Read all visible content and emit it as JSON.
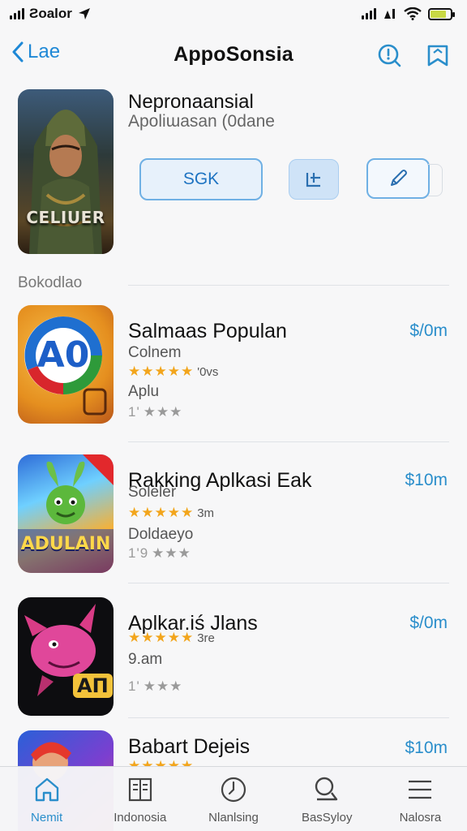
{
  "status_bar": {
    "carrier": "Ƨoalor",
    "battery_level": 0.8
  },
  "nav": {
    "back_label": "Lae",
    "title": "AppoSonsia"
  },
  "hero": {
    "title": "Nepronaansial",
    "subtitle": "Apoliɯasan (0dane",
    "cover_text": "CELIUER",
    "primary_button": "SGK"
  },
  "section": {
    "label": "Bokodlao"
  },
  "apps": [
    {
      "name": "Salmaas Populan",
      "price": "$/0m",
      "subtitle": "Colnem",
      "rating_note": "'0vs",
      "detail": "Aplu",
      "rating_gold": "★★★★★",
      "rating_grey_prefix": "1'",
      "rating_grey": "★★★",
      "icon_text": "A0"
    },
    {
      "name": "Rakking Aplkasi Eak",
      "price": "$10m",
      "subtitle": "Soleler",
      "rating_note": "3m",
      "detail": "Doldaeyo",
      "rating_gold": "★★★★★",
      "rating_grey_prefix": "1'9",
      "rating_grey": "★★★",
      "icon_text": "ADULAIN"
    },
    {
      "name": "Aplkar.iś Jlans",
      "price": "$/0m",
      "subtitle": "",
      "rating_note": "3re",
      "detail": "9.am",
      "rating_gold": "★★★★★",
      "rating_grey_prefix": "1'",
      "rating_grey": "★★★",
      "icon_text": "AΠ"
    },
    {
      "name": "Babart Dejeis",
      "price": "$10m",
      "subtitle": "",
      "rating_note": "",
      "detail": "",
      "rating_gold": "★★★★★",
      "rating_grey_prefix": "",
      "rating_grey": "",
      "icon_text": ""
    }
  ],
  "tabs": [
    {
      "label": "Nemit",
      "icon": "home-icon",
      "active": true
    },
    {
      "label": "Indonosia",
      "icon": "grid-icon",
      "active": false
    },
    {
      "label": "Nlanlsing",
      "icon": "clock-icon",
      "active": false
    },
    {
      "label": "BasSyloy",
      "icon": "search-icon",
      "active": false
    },
    {
      "label": "Nalosra",
      "icon": "menu-icon",
      "active": false
    }
  ],
  "colors": {
    "accent": "#2a8ecb",
    "star": "#f2a51c",
    "background": "#f7f7f8"
  }
}
